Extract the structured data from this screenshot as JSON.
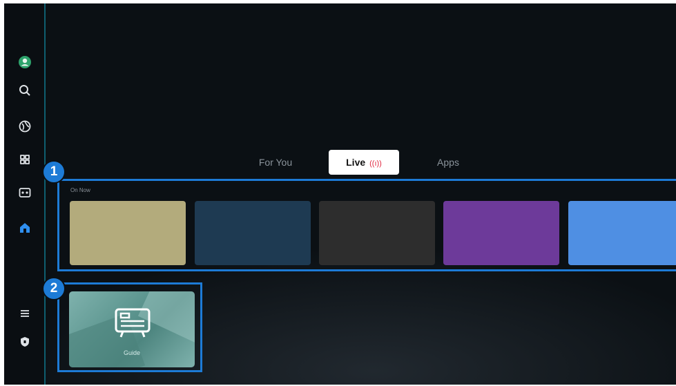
{
  "sidebar": {
    "items": [
      {
        "icon": "profile-icon"
      },
      {
        "icon": "search-icon"
      },
      {
        "icon": "ambient-icon"
      },
      {
        "icon": "apps-icon"
      },
      {
        "icon": "game-icon"
      },
      {
        "icon": "home-icon",
        "active": true
      },
      {
        "icon": "menu-icon"
      },
      {
        "icon": "privacy-icon"
      }
    ]
  },
  "tabs": [
    {
      "label": "For You"
    },
    {
      "label": "Live",
      "active": true,
      "signal": "((ı))"
    },
    {
      "label": "Apps"
    }
  ],
  "row": {
    "title": "On Now",
    "cards": [
      {
        "color": "#b3ab7c"
      },
      {
        "color": "#1e3a52"
      },
      {
        "color": "#2d2d2d"
      },
      {
        "color": "#6d3a9a"
      },
      {
        "color": "#4f8fe3"
      }
    ]
  },
  "guide": {
    "label": "Guide"
  },
  "badges": {
    "one": "1",
    "two": "2"
  },
  "colors": {
    "accent": "#1d7bd6",
    "live": "#e0233c",
    "background": "#0b1014"
  }
}
